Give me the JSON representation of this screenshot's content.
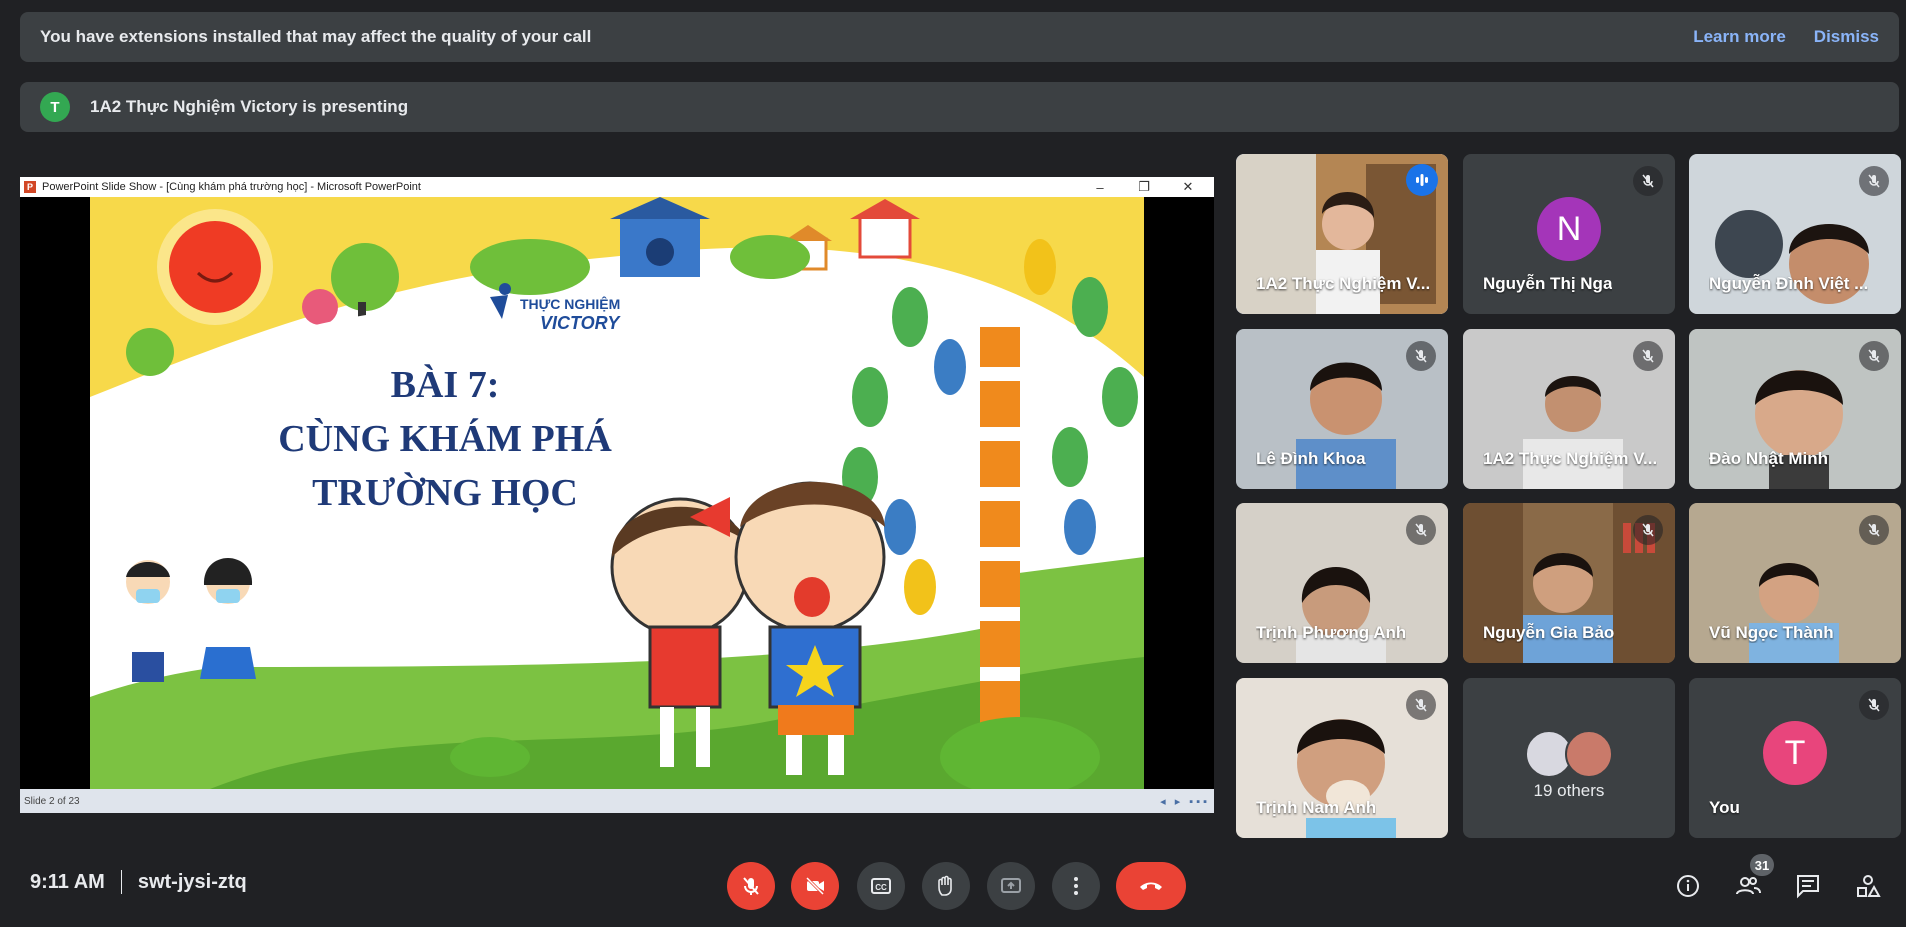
{
  "banner": {
    "message": "You have extensions installed that may affect the quality of your call",
    "learn_more": "Learn more",
    "dismiss": "Dismiss"
  },
  "presenting": {
    "avatar_initial": "T",
    "text": "1A2 Thực Nghiệm Victory is presenting"
  },
  "presentation": {
    "window_title": "PowerPoint Slide Show - [Cùng khám phá trường học] - Microsoft PowerPoint",
    "logo_line1": "THỰC NGHIỆM",
    "logo_line2": "VICTORY",
    "slide_title_1": "BÀI 7:",
    "slide_title_2": "CÙNG KHÁM PHÁ",
    "slide_title_3": "TRƯỜNG HỌC",
    "status": "Slide 2 of 23"
  },
  "participants": [
    {
      "name": "1A2 Thực Nghiệm V...",
      "speaking": true
    },
    {
      "name": "Nguyễn Thị Nga",
      "initial": "N",
      "avatar_color": "#9c27b0",
      "muted": true
    },
    {
      "name": "Nguyễn Đình Việt ...",
      "muted": true
    },
    {
      "name": "Lê Đình Khoa",
      "muted": true
    },
    {
      "name": "1A2 Thực Nghiệm V...",
      "muted": true
    },
    {
      "name": "Đào Nhật Minh",
      "muted": true
    },
    {
      "name": "Trịnh Phương Anh",
      "muted": true
    },
    {
      "name": "Nguyễn Gia Bảo",
      "muted": true
    },
    {
      "name": "Vũ Ngọc Thành",
      "muted": true
    },
    {
      "name": "Trịnh Nam Anh",
      "muted": true
    },
    {
      "others_label": "19 others"
    },
    {
      "name": "You",
      "initial": "T",
      "avatar_color": "#e8457c",
      "muted": true
    }
  ],
  "meeting": {
    "time": "9:11 AM",
    "code": "swt-jysi-ztq",
    "participant_count": "31"
  },
  "colors": {
    "background": "#202124",
    "surface": "#3c4043",
    "accent": "#8ab4f8",
    "danger": "#ea4335"
  }
}
